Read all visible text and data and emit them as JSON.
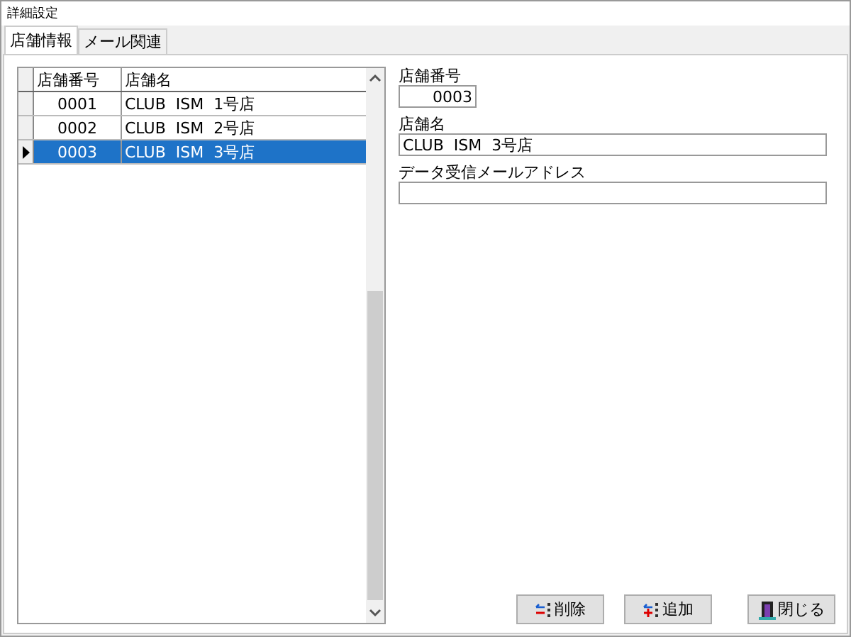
{
  "window": {
    "title": "詳細設定"
  },
  "tabs": [
    {
      "label": "店舗情報",
      "selected": true
    },
    {
      "label": "メール関連",
      "selected": false
    }
  ],
  "table": {
    "columns": [
      "店舗番号",
      "店舗名"
    ],
    "rows": [
      {
        "cells": [
          "0001",
          "CLUB  ISM  1号店"
        ],
        "selected": false
      },
      {
        "cells": [
          "0002",
          "CLUB  ISM  2号店"
        ],
        "selected": false
      },
      {
        "cells": [
          "0003",
          "CLUB  ISM  3号店"
        ],
        "selected": true
      }
    ]
  },
  "form": {
    "fields": [
      {
        "label": "店舗番号",
        "value": "0003",
        "kind": "short"
      },
      {
        "label": "店舗名",
        "value": "CLUB  ISM  3号店",
        "kind": "wide"
      },
      {
        "label": "データ受信メールアドレス",
        "kind": "wide"
      }
    ]
  },
  "buttons": [
    {
      "label": "削除",
      "kind": "delete"
    },
    {
      "label": "追加",
      "kind": "add"
    },
    {
      "label": "閉じる",
      "kind": "close"
    }
  ]
}
